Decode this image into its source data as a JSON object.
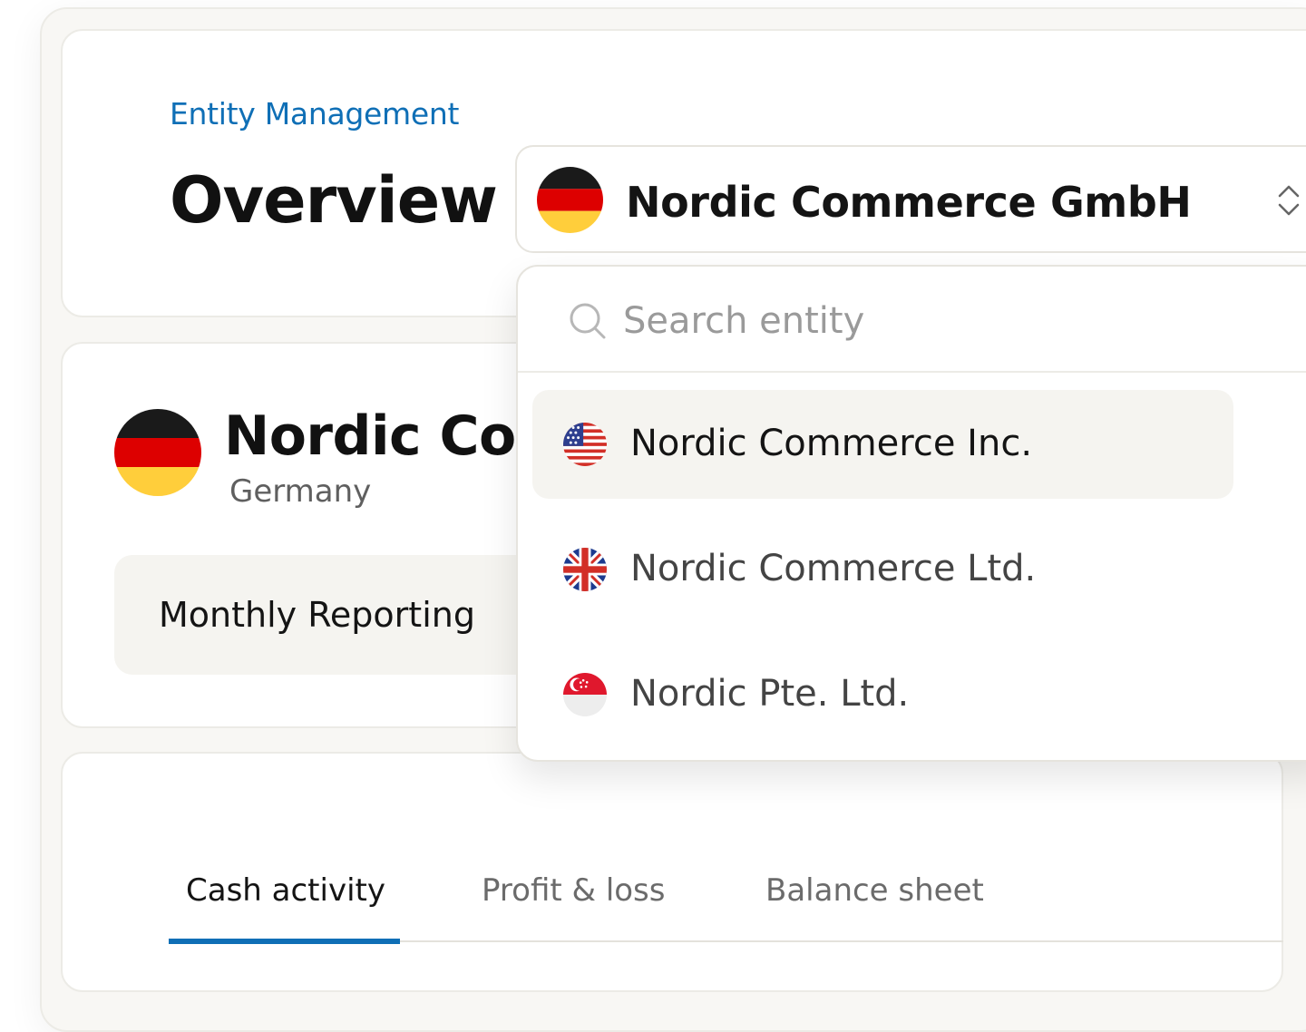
{
  "header": {
    "breadcrumb": "Entity Management",
    "title": "Overview"
  },
  "selector": {
    "selected_label": "Nordic Commerce GmbH",
    "selected_flag": "germany-flag-icon"
  },
  "entity": {
    "name": "Nordic Commerce GmbH",
    "country": "Germany",
    "reporting_label": "Monthly Reporting"
  },
  "dropdown": {
    "search_placeholder": "Search entity",
    "options": [
      {
        "label": "Nordic Commerce Inc.",
        "flag": "usa-flag-icon",
        "highlighted": true
      },
      {
        "label": "Nordic Commerce Ltd.",
        "flag": "uk-flag-icon",
        "highlighted": false
      },
      {
        "label": "Nordic Pte. Ltd.",
        "flag": "singapore-flag-icon",
        "highlighted": false
      }
    ]
  },
  "tabs": [
    {
      "label": "Cash activity",
      "active": true
    },
    {
      "label": "Profit & loss",
      "active": false
    },
    {
      "label": "Balance sheet",
      "active": false
    }
  ],
  "colors": {
    "accent": "#0f6fb6",
    "background": "#f8f7f4",
    "highlight": "#f5f4f0"
  }
}
